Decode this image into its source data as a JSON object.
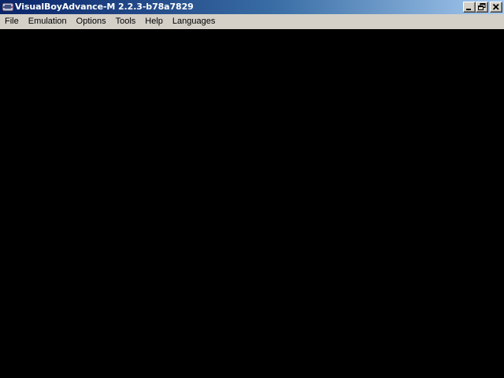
{
  "window": {
    "title": "VisualBoyAdvance-M 2.2.3-b78a7829",
    "app_icon": "gameboy-icon",
    "controls": {
      "minimize_icon": "minimize-icon",
      "restore_icon": "restore-icon",
      "close_icon": "close-icon"
    },
    "colors": {
      "titlebar_start": "#0a246a",
      "titlebar_end": "#a6caf0",
      "menubar": "#d4d0c8",
      "content": "#000000"
    }
  },
  "menubar": {
    "items": [
      {
        "label": "File"
      },
      {
        "label": "Emulation"
      },
      {
        "label": "Options"
      },
      {
        "label": "Tools"
      },
      {
        "label": "Help"
      },
      {
        "label": "Languages"
      }
    ]
  }
}
